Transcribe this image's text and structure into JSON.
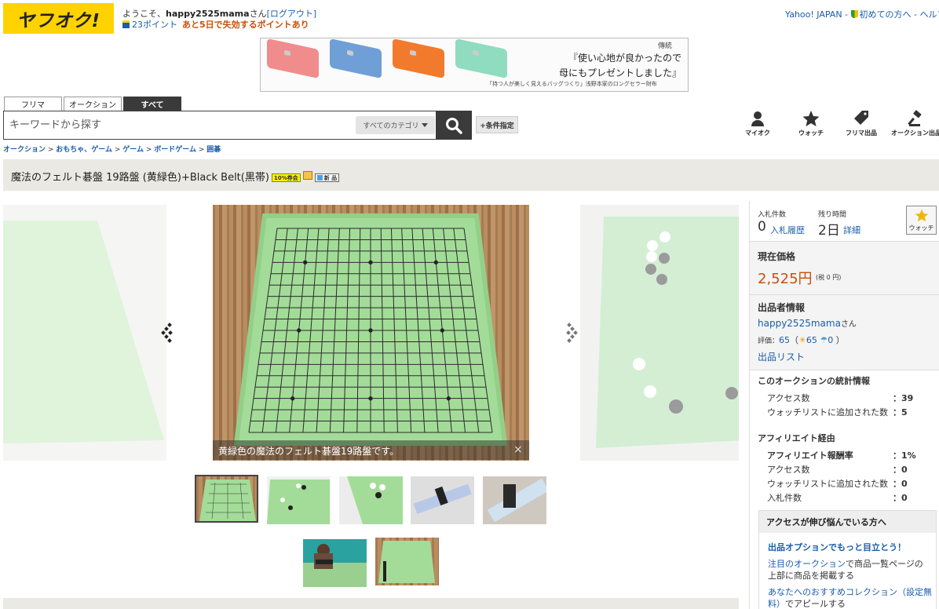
{
  "header": {
    "logo": "ヤフオク!",
    "welcome_prefix": "ようこそ、",
    "username": "happy2525mama",
    "welcome_suffix": "さん",
    "logout": "[ログアウト]",
    "points": "23ポイント",
    "points_expiry": "あと5日で失効するポイントあり",
    "yahoo_japan": "Yahoo! JAPAN",
    "first_time": "初めての方へ",
    "help": "ヘルプ"
  },
  "banner": {
    "line1": "『使い心地が良かったので",
    "line2": "母にもプレゼントしました』",
    "small": "「持つ人が美しく見えるバッグつくり」浅野本家のロングセラー財布",
    "brand": "傳統",
    "wallet_colors": [
      "#f08c8c",
      "#6f9fd6",
      "#f27a2c",
      "#8fdcc0"
    ]
  },
  "search": {
    "tabs": [
      "フリマ",
      "オークション",
      "すべて"
    ],
    "active_tab": "すべて",
    "placeholder": "キーワードから探す",
    "category": "すべてのカテゴリ",
    "condition_button": "+条件指定"
  },
  "nav_icons": [
    {
      "label": "マイオク",
      "icon": "person-icon"
    },
    {
      "label": "ウォッチ",
      "icon": "star-icon"
    },
    {
      "label": "フリマ出品",
      "icon": "tag-icon"
    },
    {
      "label": "オークション出品",
      "icon": "gavel-icon"
    }
  ],
  "breadcrumb": [
    "オークション",
    "おもちゃ、ゲーム",
    "ゲーム",
    "ボードゲーム",
    "囲碁"
  ],
  "item": {
    "title": "魔法のフェルト碁盤 19路盤 (黄緑色)+Black Belt(黒帯)",
    "badge_coupon": "10%券会",
    "badge_new": "新 品",
    "caption": "黄緑色の魔法のフェルト碁盤19路盤です。",
    "caption_close": "×"
  },
  "bid": {
    "bid_count_label": "入札件数",
    "bid_count": "0",
    "bid_history": "入札履歴",
    "time_left_label": "残り時間",
    "time_left": "2日",
    "detail": "詳細",
    "watch": "ウォッチ"
  },
  "price": {
    "label": "現在価格",
    "value": "2,525円",
    "tax": "(税 0 円)"
  },
  "seller": {
    "label": "出品者情報",
    "name": "happy2525mama",
    "name_suffix": "さん",
    "rating_label": "評価：",
    "rating": "65",
    "good": "65",
    "bad": "0",
    "list_link": "出品リスト"
  },
  "stats": {
    "title": "このオークションの統計情報",
    "rows": [
      {
        "label": "アクセス数",
        "value": "：39"
      },
      {
        "label": "ウォッチリストに追加された数",
        "value": "：5"
      }
    ]
  },
  "affiliate": {
    "title": "アフィリエイト経由",
    "rows": [
      {
        "label": "アフィリエイト報酬率",
        "value": "：1%"
      },
      {
        "label": "アクセス数",
        "value": "：0"
      },
      {
        "label": "ウォッチリストに追加された数",
        "value": "：0"
      },
      {
        "label": "入札件数",
        "value": "：0"
      }
    ]
  },
  "promo": {
    "title": "アクセスが伸び悩んでいる方へ",
    "headline": "出品オプションでもっと目立とう！",
    "text1_link": "注目のオークション",
    "text1_rest": "で商品一覧ページの上部に商品を掲載する",
    "text2_link": "あなたへのおすすめコレクション（設定無料）",
    "text2_rest": "でアピールする"
  }
}
